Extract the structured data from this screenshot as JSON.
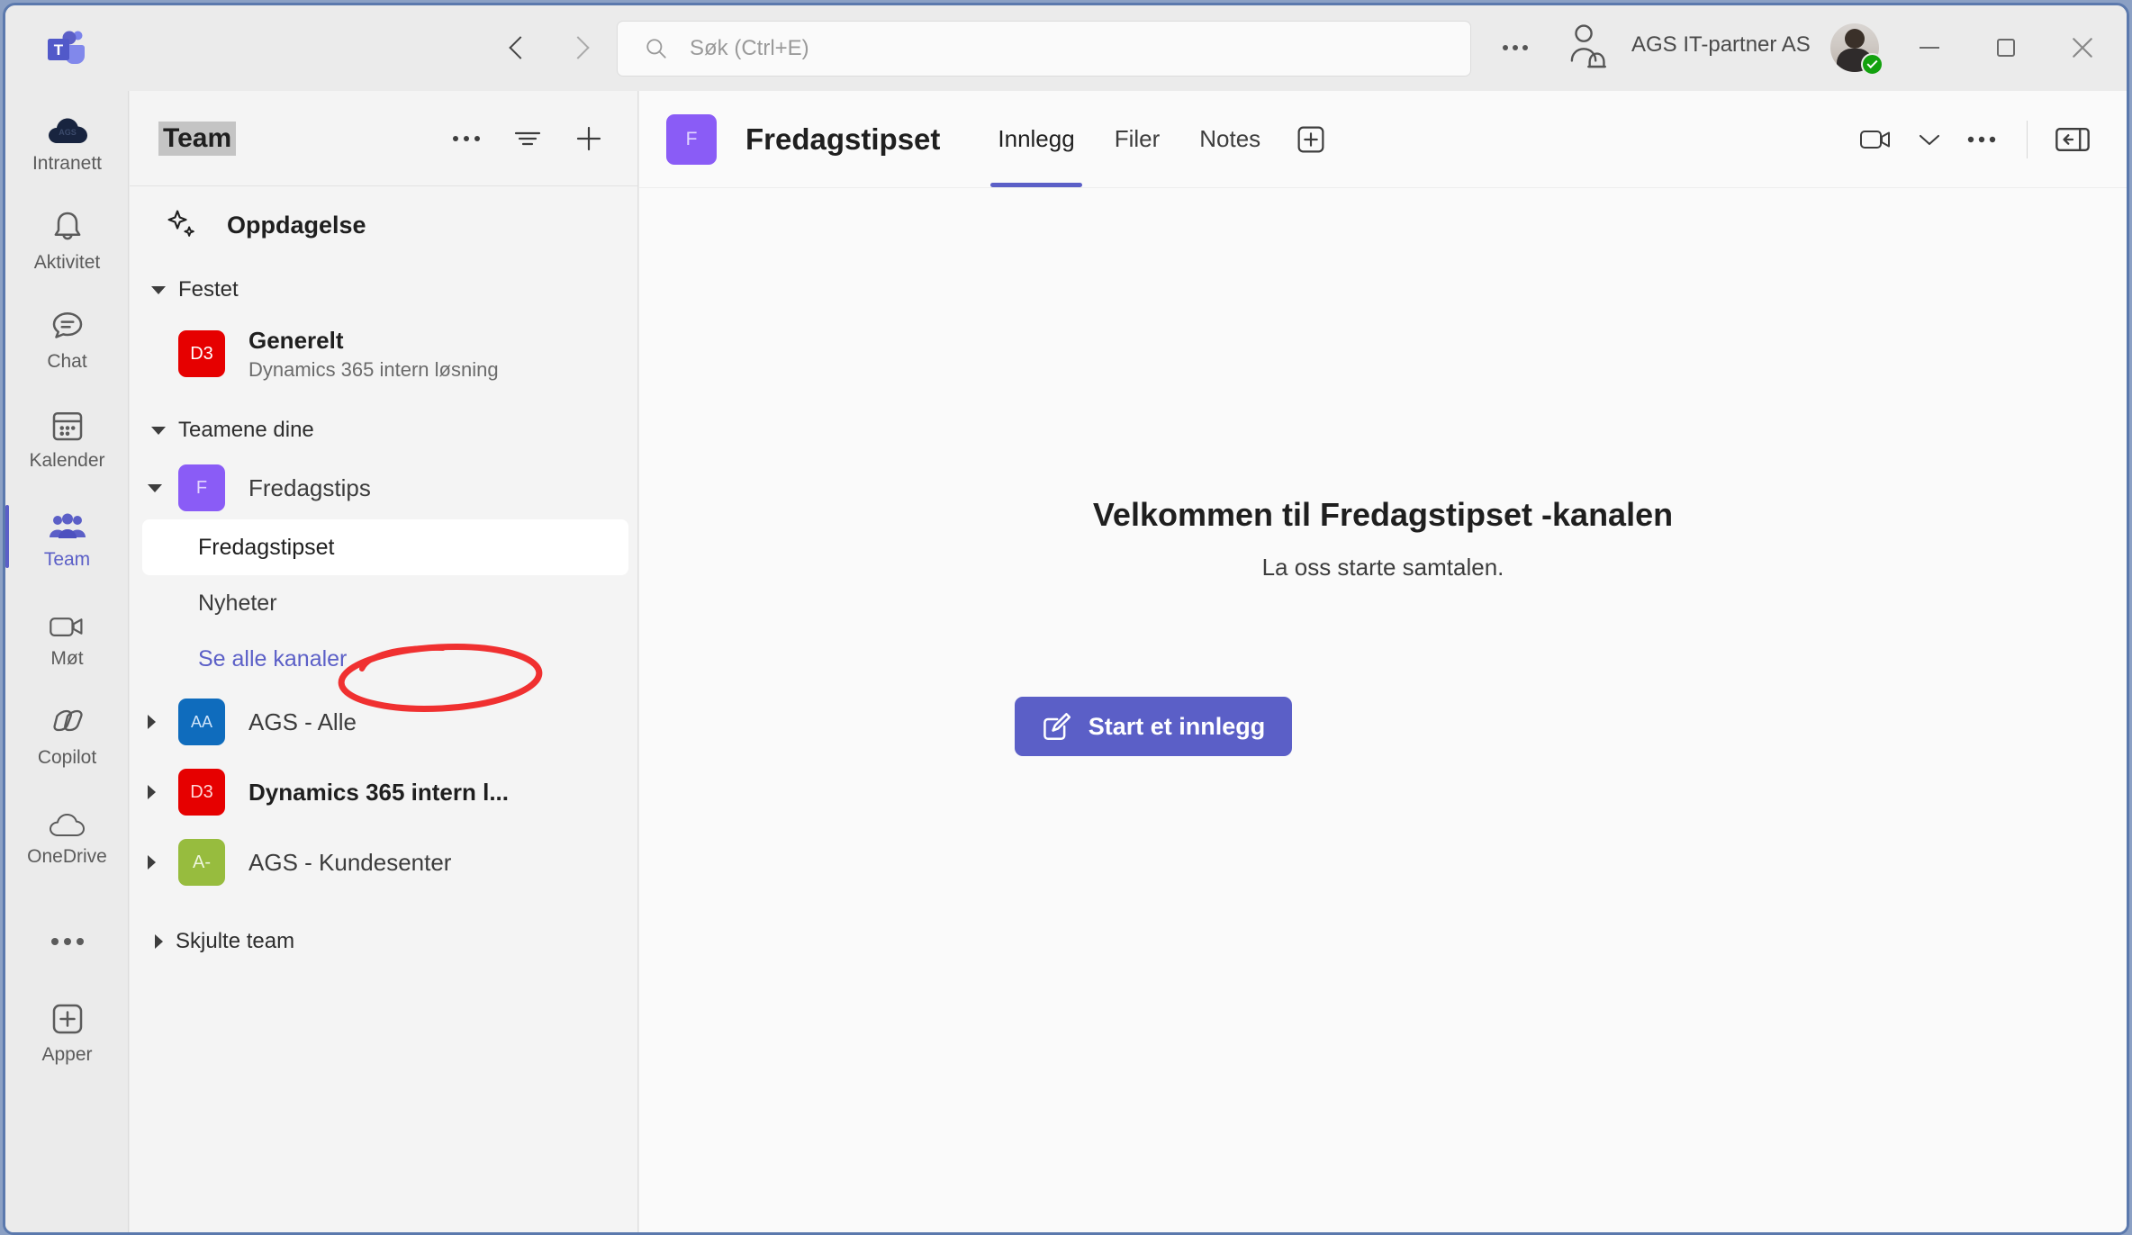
{
  "titlebar": {
    "logo_icon": "teams-logo",
    "back_icon": "chevron-left-icon",
    "forward_icon": "chevron-right-icon",
    "more_icon": "more-horizontal-icon",
    "presence_icon": "person-bell-icon",
    "org_name": "AGS IT-partner AS",
    "avatar_icon": "user-avatar",
    "status_badge": "available-check-badge",
    "minimize_icon": "minimize-icon",
    "maximize_icon": "maximize-icon",
    "close_icon": "close-icon"
  },
  "search": {
    "icon": "search-icon",
    "placeholder": "Søk (Ctrl+E)",
    "value": ""
  },
  "rail": {
    "items": [
      {
        "label": "Intranett",
        "icon": "cloud-ags-icon",
        "active": false
      },
      {
        "label": "Aktivitet",
        "icon": "bell-icon",
        "active": false
      },
      {
        "label": "Chat",
        "icon": "chat-bubble-icon",
        "active": false
      },
      {
        "label": "Kalender",
        "icon": "calendar-icon",
        "active": false
      },
      {
        "label": "Team",
        "icon": "people-icon",
        "active": true
      },
      {
        "label": "Møt",
        "icon": "video-camera-icon",
        "active": false
      },
      {
        "label": "Copilot",
        "icon": "copilot-icon",
        "active": false
      },
      {
        "label": "OneDrive",
        "icon": "cloud-icon",
        "active": false
      },
      {
        "label": "",
        "icon": "more-horizontal-icon",
        "active": false
      },
      {
        "label": "Apper",
        "icon": "plus-square-icon",
        "active": false
      }
    ]
  },
  "sidebar": {
    "title": "Team",
    "more_icon": "more-horizontal-icon",
    "filter_icon": "filter-icon",
    "add_icon": "plus-icon",
    "discover": {
      "label": "Oppdagelse",
      "icon": "sparkle-icon"
    },
    "groups": [
      {
        "label": "Festet",
        "expanded": true,
        "teams": [
          {
            "name": "Generelt",
            "subtitle": "Dynamics 365 intern løsning",
            "initials": "D3",
            "color": "#e60000",
            "bold": true,
            "caret": "none",
            "channels": []
          }
        ]
      },
      {
        "label": "Teamene dine",
        "expanded": true,
        "teams": [
          {
            "name": "Fredagstips",
            "subtitle": "",
            "initials": "F",
            "color": "#8a5cf6",
            "bold": false,
            "caret": "down",
            "channels": [
              {
                "name": "Fredagstipset",
                "selected": true
              },
              {
                "name": "Nyheter",
                "selected": false
              }
            ],
            "see_all_label": "Se alle kanaler"
          },
          {
            "name": "AGS - Alle",
            "subtitle": "",
            "initials": "AA",
            "color": "#0f6cbd",
            "bold": false,
            "caret": "right",
            "channels": []
          },
          {
            "name": "Dynamics 365 intern l...",
            "subtitle": "",
            "initials": "D3",
            "color": "#e60000",
            "bold": true,
            "caret": "right",
            "channels": []
          },
          {
            "name": "AGS - Kundesenter",
            "subtitle": "",
            "initials": "A-",
            "color": "#97bc3e",
            "bold": false,
            "caret": "right",
            "channels": []
          }
        ]
      },
      {
        "label": "Skjulte team",
        "expanded": false,
        "teams": []
      }
    ],
    "annotation": {
      "shape": "red-ellipse",
      "color": "#f03030",
      "targets": "Fredagstipset"
    }
  },
  "channel": {
    "initials": "F",
    "avatar_color": "#8a5cf6",
    "title": "Fredagstipset",
    "tabs": [
      {
        "label": "Innlegg",
        "active": true
      },
      {
        "label": "Filer",
        "active": false
      },
      {
        "label": "Notes",
        "active": false
      }
    ],
    "add_tab_icon": "plus-square-icon",
    "meet_icon": "video-camera-icon",
    "meet_chevron_icon": "chevron-down-icon",
    "more_icon": "more-horizontal-icon",
    "panel_icon": "open-panel-icon"
  },
  "empty_state": {
    "illustration": "people-chat-bubbles-illustration",
    "title": "Velkommen til Fredagstipset -kanalen",
    "subtitle": "La oss starte samtalen.",
    "button_label": "Start et innlegg",
    "button_icon": "compose-icon",
    "button_color": "#5b5fc7"
  }
}
